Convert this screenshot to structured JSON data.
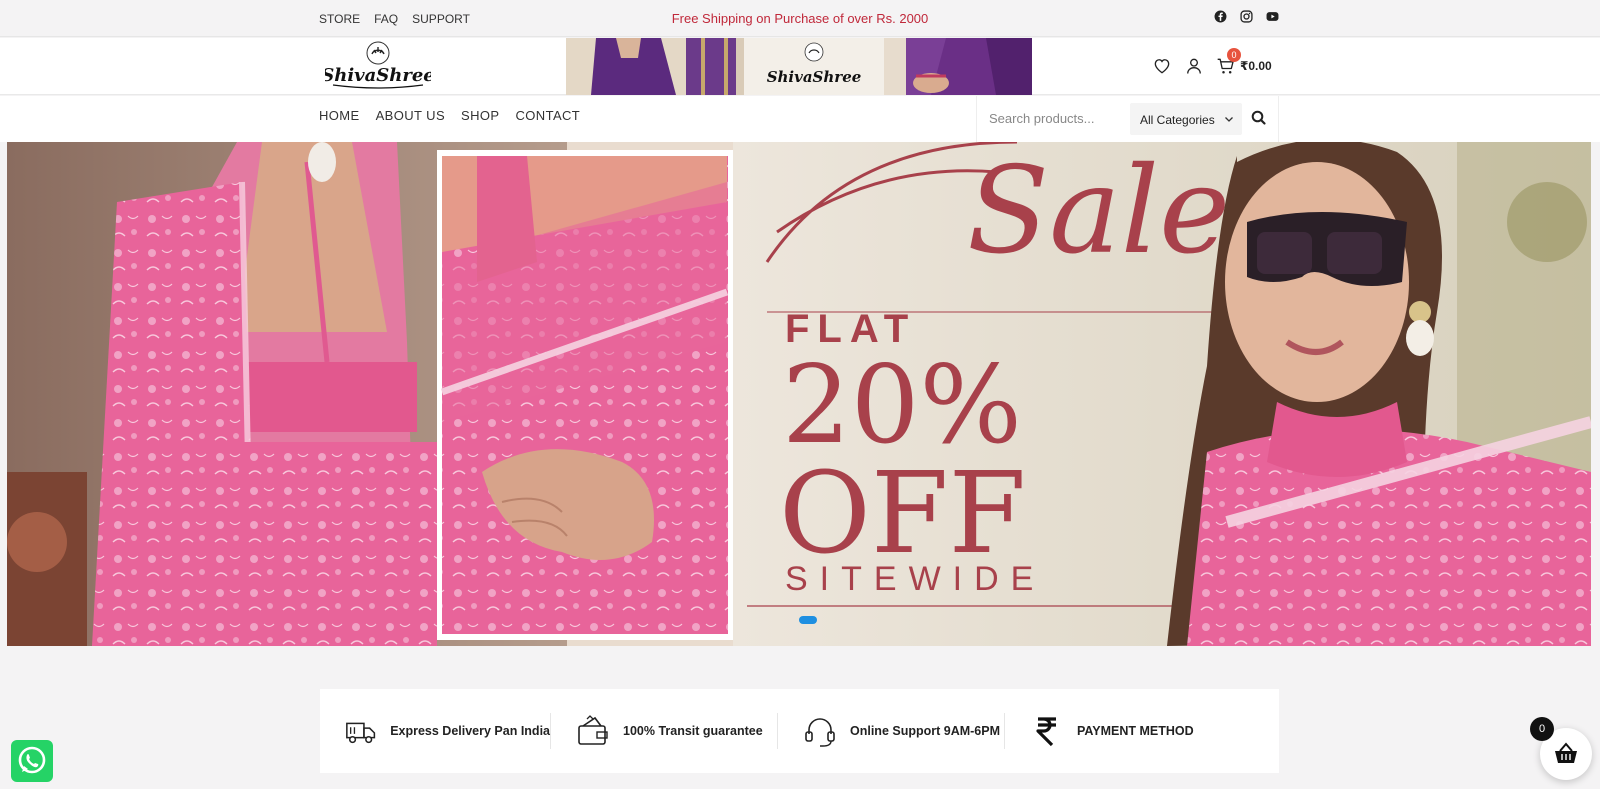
{
  "topbar": {
    "links": [
      "STORE",
      "FAQ",
      "SUPPORT"
    ],
    "promo": "Free Shipping on Purchase of over Rs. 2000",
    "social_icons": [
      "facebook-icon",
      "instagram-icon",
      "youtube-icon"
    ]
  },
  "header": {
    "logo_text": "ShivaShree",
    "cart_count": "0",
    "cart_total": "₹0.00"
  },
  "nav": {
    "items": [
      "HOME",
      "ABOUT US",
      "SHOP",
      "CONTACT"
    ],
    "search_placeholder": "Search products...",
    "category": "All Categories"
  },
  "hero": {
    "script_text": "Sale",
    "flat": "FLAT",
    "percent": "20%",
    "off": "OFF",
    "sitewide": "SITEWIDE",
    "slide_count": 1,
    "active_slide": 1
  },
  "features": [
    {
      "icon": "delivery-truck-icon",
      "label": "Express Delivery Pan India"
    },
    {
      "icon": "wallet-icon",
      "label": "100% Transit guarantee"
    },
    {
      "icon": "headset-icon",
      "label": "Online Support 9AM-6PM"
    },
    {
      "icon": "rupee-icon",
      "label": "PAYMENT METHOD"
    }
  ],
  "floating": {
    "basket_count": "0"
  },
  "colors": {
    "promo": "#c0283a",
    "badge": "#e7533e",
    "hero_text": "#a8414b",
    "saree_pink": "#e8649a",
    "slider_dot": "#1e8fe1",
    "whatsapp": "#25d366"
  }
}
